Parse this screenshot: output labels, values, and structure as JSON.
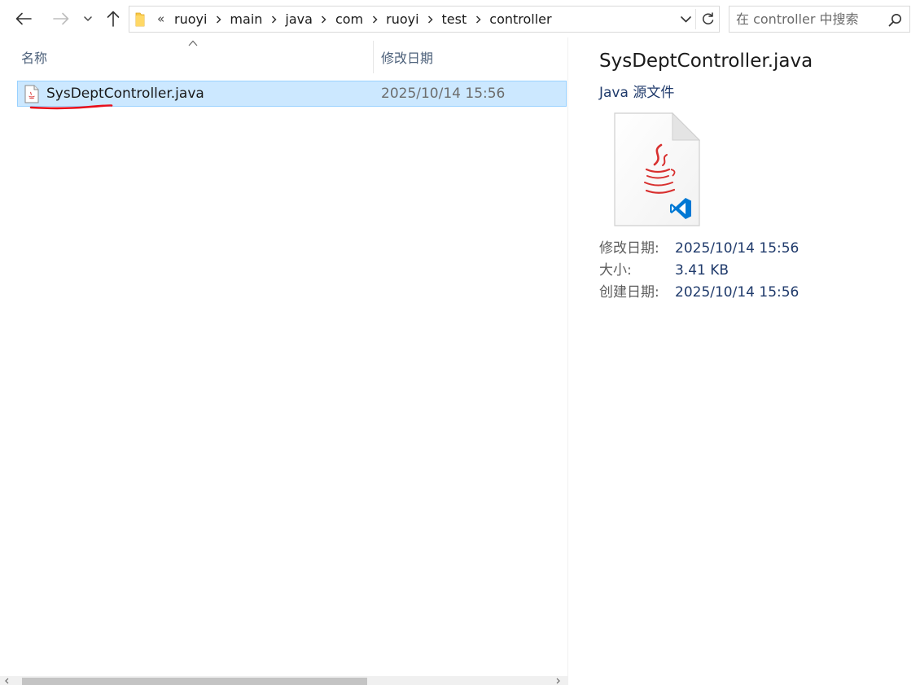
{
  "nav": {
    "back_label": "Back",
    "forward_label": "Forward",
    "recent_label": "Recent locations",
    "up_label": "Up"
  },
  "address": {
    "overflow": "«",
    "crumbs": [
      "ruoyi",
      "main",
      "java",
      "com",
      "ruoyi",
      "test",
      "controller"
    ]
  },
  "search": {
    "placeholder": "在 controller 中搜索"
  },
  "list": {
    "columns": {
      "name": "名称",
      "modified": "修改日期"
    },
    "rows": [
      {
        "name": "SysDeptController.java",
        "modified": "2025/10/14 15:56",
        "selected": true
      }
    ]
  },
  "details": {
    "title": "SysDeptController.java",
    "type": "Java 源文件",
    "props": [
      {
        "label": "修改日期:",
        "value": "2025/10/14 15:56"
      },
      {
        "label": "大小:",
        "value": "3.41 KB"
      },
      {
        "label": "创建日期:",
        "value": "2025/10/14 15:56"
      }
    ]
  },
  "colors": {
    "selection_bg": "#cce8ff",
    "selection_border": "#99d1ff",
    "annotation_red": "#e8101c",
    "java_red": "#d8302f",
    "vscode_blue": "#0078d4"
  },
  "icons": {
    "back": "arrow-left-icon",
    "forward": "arrow-right-icon",
    "recent": "chevron-down-icon",
    "up": "arrow-up-icon",
    "folder": "folder-icon",
    "refresh": "refresh-icon",
    "search": "search-icon",
    "java_file": "java-file-icon",
    "vscode": "vscode-icon"
  }
}
